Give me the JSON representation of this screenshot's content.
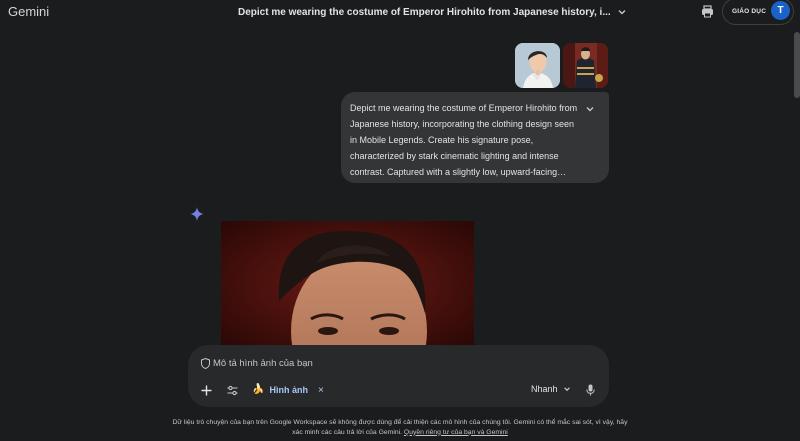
{
  "header": {
    "brand": "Gemini",
    "chat_title": "Depict me wearing the costume of Emperor Hirohito from Japanese history, i...",
    "edu_label": "GIÁO DỤC",
    "avatar_initial": "T"
  },
  "icons": {
    "title_chevron": "chevron-down-icon",
    "tool": "print-icon",
    "spark": "gemini-spark-icon",
    "shield": "shield-icon",
    "add": "plus-icon",
    "tune": "tune-icon",
    "close": "close-icon",
    "mic": "mic-icon"
  },
  "user_message": {
    "text": "Depict me wearing the costume of Emperor Hirohito from Japanese history, incorporating the clothing design seen in Mobile Legends. Create his signature pose, characterized by stark cinematic lighting and intense contrast. Captured with a slightly low, upward-facing…"
  },
  "composer": {
    "placeholder": "Mô tả hình ảnh của bạn",
    "chip_icon": "🍌",
    "chip_label": "Hình ảnh",
    "chip_close": "×",
    "mode_label": "Nhanh"
  },
  "footer": {
    "disclaimer_line1": "Dữ liệu trò chuyện của bạn trên Google Workspace sẽ không được dùng để cải thiện các mô hình của chúng tôi. Gemini có thể mắc sai sót, vì vậy, hãy",
    "disclaimer_line2": "xác minh các câu trả lời của Gemini.",
    "privacy_link": "Quyền riêng tư của bạn và Gemini"
  },
  "colors": {
    "background": "#1b1c1d",
    "bubble": "#333537",
    "composer": "#28292a",
    "accent": "#a8c7fa",
    "avatar": "#1a62c7"
  }
}
